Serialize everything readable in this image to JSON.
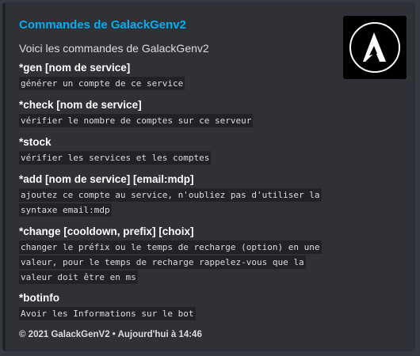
{
  "embed": {
    "title": "Commandes de GalackGenv2",
    "description": "Voici les commandes de GalackGenv2",
    "thumbnail_icon": "galack-logo-icon",
    "accent_color": "#202225",
    "title_color": "#00b0f4",
    "commands": [
      {
        "name": "*gen [nom de service]",
        "description": "générer un compte de ce service"
      },
      {
        "name": "*check [nom de service]",
        "description": "vérifier le nombre de comptes sur ce serveur"
      },
      {
        "name": "*stock",
        "description": "vérifier les services et les comptes"
      },
      {
        "name": "*add [nom de service] [email:mdp]",
        "description": "ajoutez ce compte au service, n'oubliez pas d'utiliser la syntaxe email:mdp"
      },
      {
        "name": "*change [cooldown, prefix] [choix]",
        "description": "changer le préfix ou le temps de recharge (option) en une valeur, pour le temps de recharge rappelez-vous que la valeur doit être en ms"
      },
      {
        "name": "*botinfo",
        "description": "Avoir les Informations sur le bot"
      }
    ],
    "footer": "© 2021 GalackGenV2 • Aujourd'hui à 14:46"
  }
}
